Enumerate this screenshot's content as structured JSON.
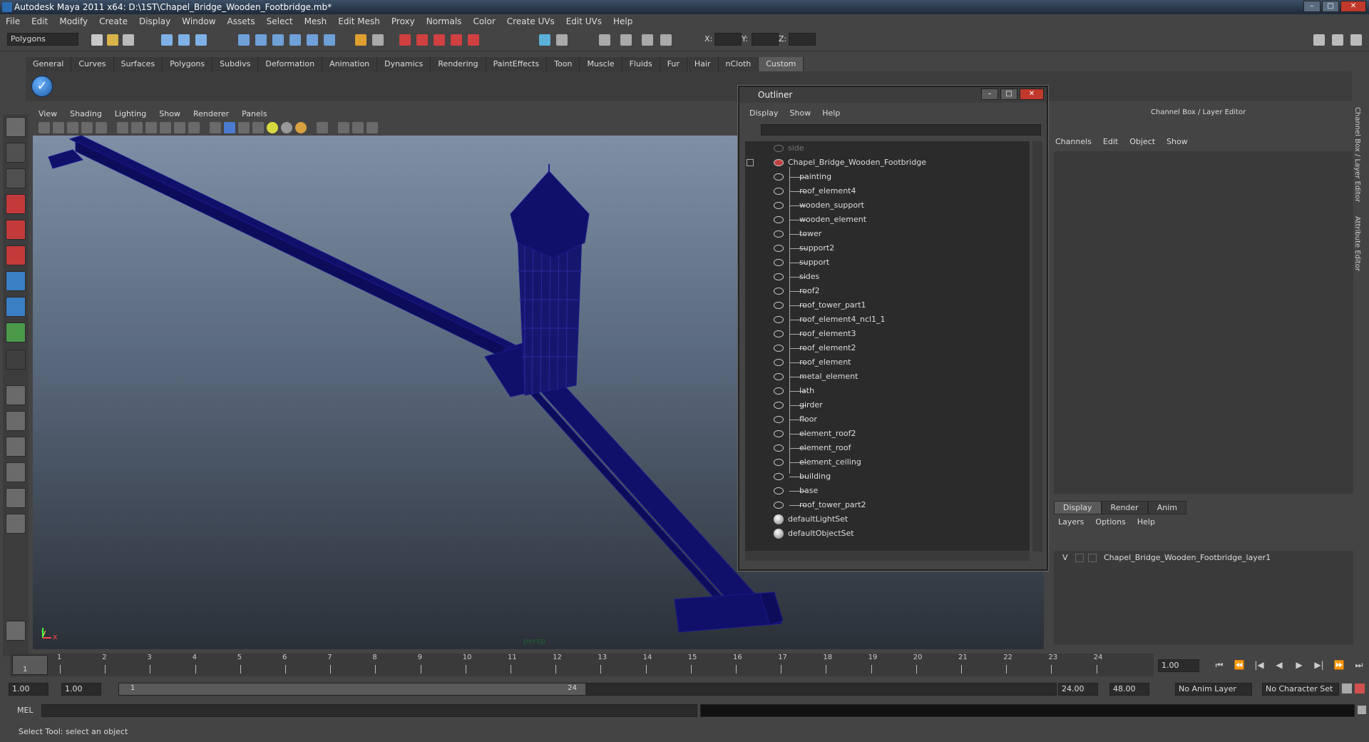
{
  "window": {
    "title": "Autodesk Maya 2011 x64: D:\\1ST\\Chapel_Bridge_Wooden_Footbridge.mb*",
    "min": "–",
    "max": "□",
    "close": "✕"
  },
  "menus": [
    "File",
    "Edit",
    "Modify",
    "Create",
    "Display",
    "Window",
    "Assets",
    "Select",
    "Mesh",
    "Edit Mesh",
    "Proxy",
    "Normals",
    "Color",
    "Create UVs",
    "Edit UVs",
    "Help"
  ],
  "status": {
    "mode": "Polygons",
    "x_label": "X:",
    "y_label": "Y:",
    "z_label": "Z:"
  },
  "shelf_tabs": [
    "General",
    "Curves",
    "Surfaces",
    "Polygons",
    "Subdivs",
    "Deformation",
    "Animation",
    "Dynamics",
    "Rendering",
    "PaintEffects",
    "Toon",
    "Muscle",
    "Fluids",
    "Fur",
    "Hair",
    "nCloth",
    "Custom"
  ],
  "active_shelf": "Custom",
  "viewport": {
    "menu": [
      "View",
      "Shading",
      "Lighting",
      "Show",
      "Renderer",
      "Panels"
    ],
    "camera": "persp",
    "axis_y": "y",
    "axis_x": "x",
    "mesh_color": "#10106a"
  },
  "outliner": {
    "title": "Outliner",
    "menu": [
      "Display",
      "Show",
      "Help"
    ],
    "items": [
      {
        "label": "side",
        "type": "camera",
        "dim": true
      },
      {
        "label": "Chapel_Bridge_Wooden_Footbridge",
        "type": "group"
      },
      {
        "label": "painting",
        "type": "child"
      },
      {
        "label": "roof_element4",
        "type": "child"
      },
      {
        "label": "wooden_support",
        "type": "child"
      },
      {
        "label": "wooden_element",
        "type": "child"
      },
      {
        "label": "tower",
        "type": "child"
      },
      {
        "label": "support2",
        "type": "child"
      },
      {
        "label": "support",
        "type": "child"
      },
      {
        "label": "sides",
        "type": "child"
      },
      {
        "label": "roof2",
        "type": "child"
      },
      {
        "label": "roof_tower_part1",
        "type": "child"
      },
      {
        "label": "roof_element4_ncl1_1",
        "type": "child"
      },
      {
        "label": "roof_element3",
        "type": "child"
      },
      {
        "label": "roof_element2",
        "type": "child"
      },
      {
        "label": "roof_element",
        "type": "child"
      },
      {
        "label": "metal_element",
        "type": "child"
      },
      {
        "label": "lath",
        "type": "child"
      },
      {
        "label": "girder",
        "type": "child"
      },
      {
        "label": "floor",
        "type": "child"
      },
      {
        "label": "element_roof2",
        "type": "child"
      },
      {
        "label": "element_roof",
        "type": "child"
      },
      {
        "label": "element_ceiling",
        "type": "child"
      },
      {
        "label": "building",
        "type": "child"
      },
      {
        "label": "base",
        "type": "child"
      },
      {
        "label": "roof_tower_part2",
        "type": "child"
      },
      {
        "label": "defaultLightSet",
        "type": "set"
      },
      {
        "label": "defaultObjectSet",
        "type": "set"
      }
    ]
  },
  "channel_box": {
    "title": "Channel Box / Layer Editor",
    "menu": [
      "Channels",
      "Edit",
      "Object",
      "Show"
    ],
    "layer_tabs": [
      "Display",
      "Render",
      "Anim"
    ],
    "layer_menu": [
      "Layers",
      "Options",
      "Help"
    ],
    "layer": {
      "visible": "V",
      "name": "Chapel_Bridge_Wooden_Footbridge_layer1"
    },
    "side_tabs": [
      "Channel Box / Layer Editor",
      "Attribute Editor"
    ]
  },
  "timeline": {
    "ticks": [
      "1",
      "2",
      "3",
      "4",
      "5",
      "6",
      "7",
      "8",
      "9",
      "10",
      "11",
      "12",
      "13",
      "14",
      "15",
      "16",
      "17",
      "18",
      "19",
      "20",
      "21",
      "22",
      "23",
      "24"
    ],
    "current_frame": "1",
    "current_time": "1.00"
  },
  "range": {
    "start": "1.00",
    "playback_start": "1.00",
    "slider_start": "1",
    "slider_end": "24",
    "playback_end": "24.00",
    "end": "48.00",
    "anim_layer": "No Anim Layer",
    "character_set": "No Character Set"
  },
  "command_line": {
    "label": "MEL"
  },
  "help_line": "Select Tool: select an object"
}
